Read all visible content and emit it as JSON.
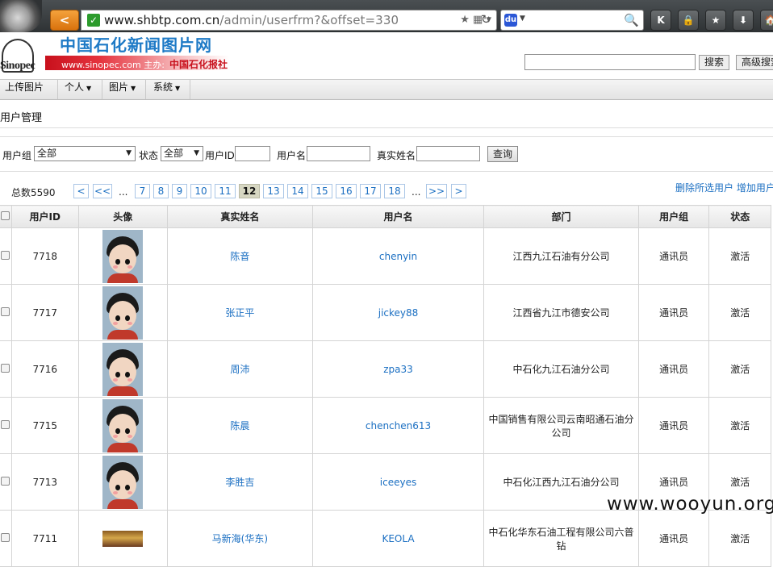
{
  "browser": {
    "url_host": "www.shbtp.com.cn",
    "url_path": "/admin/userfrm?&offset=330",
    "back_label": "<",
    "engine_label": "du",
    "toolbar_labels": [
      "K",
      "🔒",
      "★",
      "⬇",
      "🏠"
    ]
  },
  "site": {
    "logo_text": "Sinopec",
    "title": "中国石化新闻图片网",
    "sub_host": "www.sinopec.com",
    "sub_sponsor": "主办:",
    "sub_org": "中国石化报社",
    "search_button": "搜索",
    "advanced_search": "高级搜索"
  },
  "menu": [
    {
      "label": "上传图片",
      "has_caret": false
    },
    {
      "label": "个人",
      "has_caret": true
    },
    {
      "label": "图片",
      "has_caret": true
    },
    {
      "label": "系统",
      "has_caret": true
    }
  ],
  "page_title": "用户管理",
  "filter": {
    "group_label": "用户组",
    "group_value": "全部",
    "status_label": "状态",
    "status_value": "全部",
    "userid_label": "用户ID",
    "username_label": "用户名",
    "realname_label": "真实姓名",
    "query_button": "查询"
  },
  "pager": {
    "total": "总数5590",
    "first": "<",
    "prev_many": "<<",
    "dots": "...",
    "pages": [
      "7",
      "8",
      "9",
      "10",
      "11",
      "12",
      "13",
      "14",
      "15",
      "16",
      "17",
      "18"
    ],
    "current": "12",
    "next_many": ">>",
    "last": ">"
  },
  "actions": {
    "delete_selected": "删除所选用户",
    "add_user": "增加用户"
  },
  "table": {
    "headers": [
      "用户ID",
      "头像",
      "真实姓名",
      "用户名",
      "部门",
      "用户组",
      "状态"
    ],
    "rows": [
      {
        "id": "7718",
        "name": "陈音",
        "username": "chenyin",
        "dept": "江西九江石油有分公司",
        "group": "通讯员",
        "status": "激活"
      },
      {
        "id": "7717",
        "name": "张正平",
        "username": "jickey88",
        "dept": "江西省九江市德安公司",
        "group": "通讯员",
        "status": "激活"
      },
      {
        "id": "7716",
        "name": "周沛",
        "username": "zpa33",
        "dept": "中石化九江石油分公司",
        "group": "通讯员",
        "status": "激活"
      },
      {
        "id": "7715",
        "name": "陈晨",
        "username": "chenchen613",
        "dept": "中国销售有限公司云南昭通石油分公司",
        "group": "通讯员",
        "status": "激活"
      },
      {
        "id": "7713",
        "name": "李胜吉",
        "username": "iceeyes",
        "dept": "中石化江西九江石油分公司",
        "group": "通讯员",
        "status": "激活"
      },
      {
        "id": "7711",
        "name": "马新海(华东)",
        "username": "KEOLA",
        "dept": "中石化华东石油工程有限公司六普钻",
        "group": "通讯员",
        "status": "激活"
      }
    ]
  },
  "watermark": "www.wooyun.org"
}
